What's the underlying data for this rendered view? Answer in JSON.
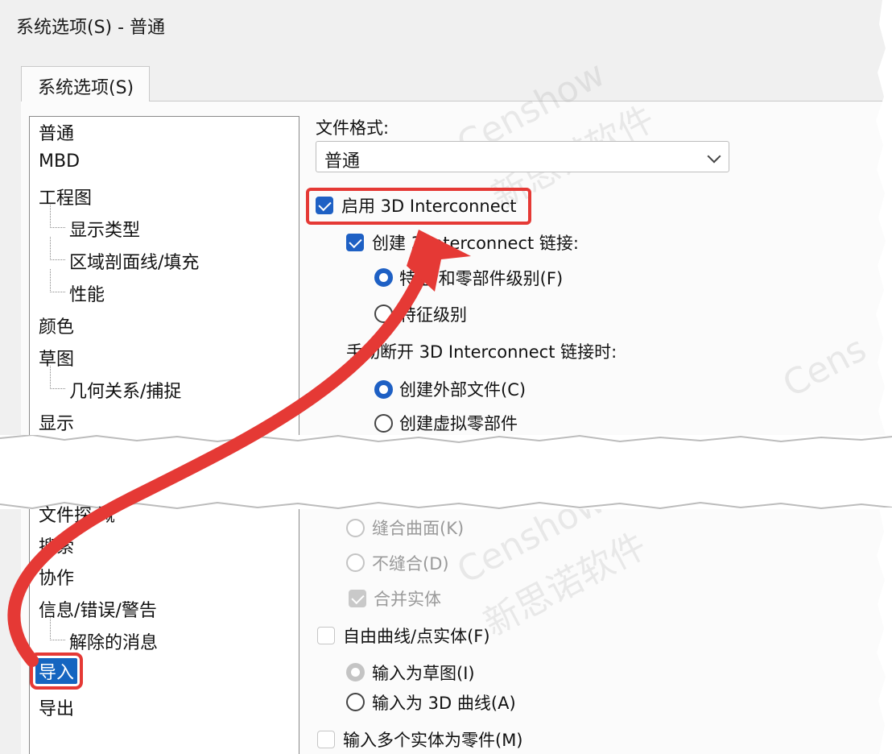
{
  "window": {
    "title": "系统选项(S) - 普通",
    "tab": "系统选项(S)"
  },
  "tree": {
    "items_top": [
      {
        "label": "普通"
      },
      {
        "label": "MBD"
      },
      {
        "label": "工程图"
      },
      {
        "label": "显示类型"
      },
      {
        "label": "区域剖面线/填充"
      },
      {
        "label": "性能"
      },
      {
        "label": "颜色"
      },
      {
        "label": "草图"
      },
      {
        "label": "几何关系/捕捉"
      },
      {
        "label": "显示"
      }
    ],
    "items_bottom": [
      {
        "label": "文件探 溉"
      },
      {
        "label": "搜索"
      },
      {
        "label": "协作"
      },
      {
        "label": "信息/错误/警告"
      },
      {
        "label": "解除的消息"
      },
      {
        "label": "导入"
      },
      {
        "label": "导出"
      }
    ]
  },
  "content": {
    "file_format_label": "文件格式:",
    "file_format_value": "普通",
    "enable_3di": "启用 3D Interconnect",
    "create_link": "创建 3 Interconnect 链接:",
    "radio_feature_part": "特征 和零部件级别(F)",
    "radio_feature": "特征级别",
    "manual_break": "手动断开 3D Interconnect 链接时:",
    "radio_ext_file": "创建外部文件(C)",
    "radio_virtual": "创建虚拟零部件",
    "radio_knit": "缝合曲面(K)",
    "radio_no_knit": "不缝合(D)",
    "merge_bodies": "合并实体",
    "freeform": "自由曲线/点实体(F)",
    "as_sketch": "输入为草图(I)",
    "as_3d_curve": "输入为 3D 曲线(A)",
    "multi_body": "输入多个实体为零件(M)"
  },
  "colors": {
    "accent": "#1e60c4",
    "annotation": "#e53935"
  }
}
